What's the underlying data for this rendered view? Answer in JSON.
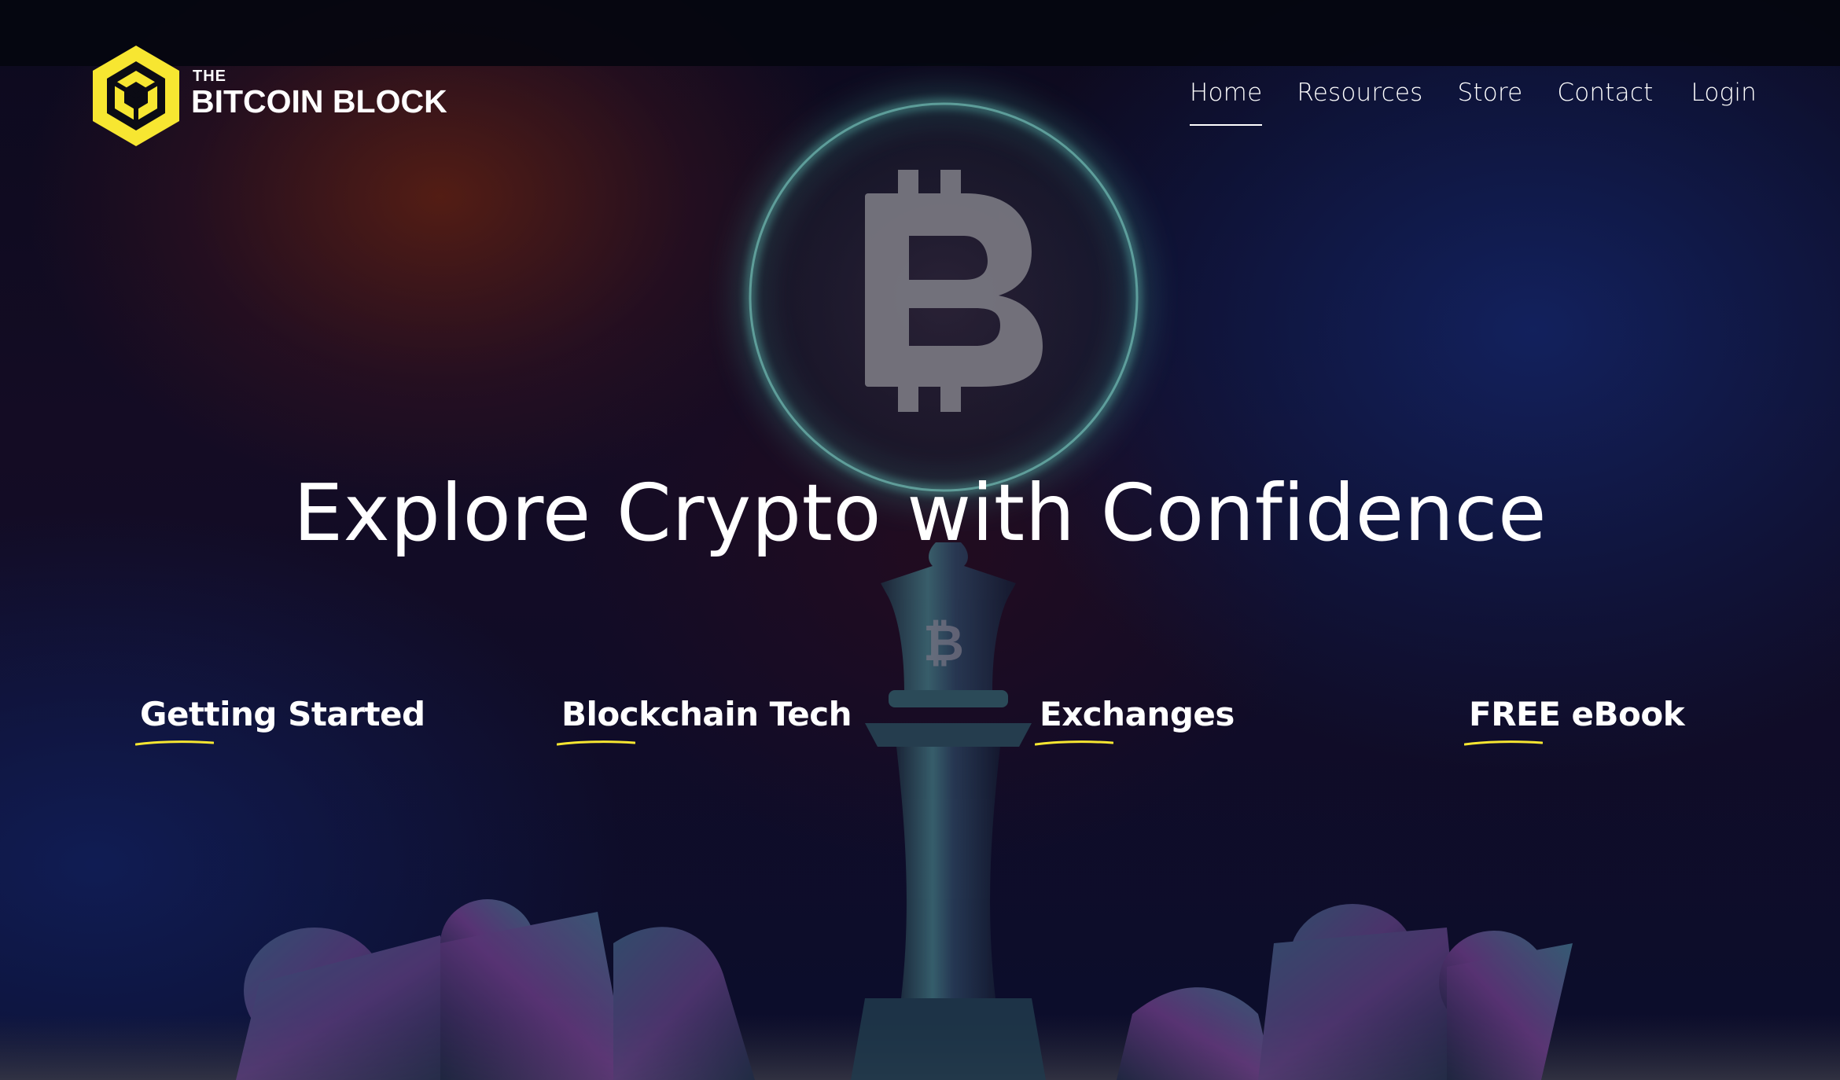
{
  "brand": {
    "small": "THE",
    "name": "BITCOIN BLOCK",
    "accent": "#F7E631"
  },
  "nav": {
    "items": [
      {
        "label": "Home",
        "active": true
      },
      {
        "label": "Resources"
      },
      {
        "label": "Store"
      },
      {
        "label": "Contact"
      },
      {
        "label": "Login"
      }
    ]
  },
  "hero": {
    "headline": "Explore Crypto with Confidence",
    "links": [
      {
        "label": "Getting Started"
      },
      {
        "label": "Blockchain Tech"
      },
      {
        "label": "Exchanges"
      },
      {
        "label": "FREE eBook"
      }
    ]
  },
  "colors": {
    "text": "#FFFFFF",
    "underline": "#F7E631",
    "coin_ring": "#4FA59E"
  }
}
